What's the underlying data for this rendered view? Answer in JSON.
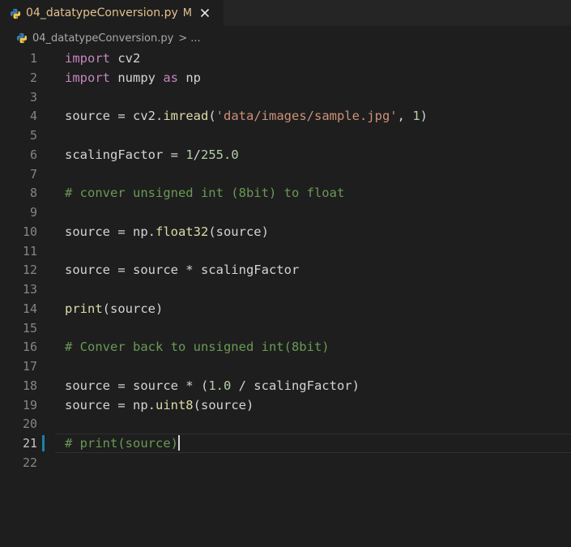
{
  "tab": {
    "title": "04_datatypeConversion.py",
    "status": "M",
    "file_icon": "python-icon",
    "close_icon": "close-icon"
  },
  "breadcrumb": {
    "file": "04_datatypeConversion.py",
    "separator": ">",
    "more": "..."
  },
  "editor": {
    "current_line": 21,
    "lines": [
      {
        "n": "1",
        "tokens": [
          {
            "t": "import",
            "c": "kw"
          },
          {
            "t": " cv2",
            "c": ""
          }
        ]
      },
      {
        "n": "2",
        "tokens": [
          {
            "t": "import",
            "c": "kw"
          },
          {
            "t": " numpy ",
            "c": ""
          },
          {
            "t": "as",
            "c": "kw"
          },
          {
            "t": " np",
            "c": ""
          }
        ]
      },
      {
        "n": "3",
        "tokens": []
      },
      {
        "n": "4",
        "tokens": [
          {
            "t": "source = cv2.",
            "c": ""
          },
          {
            "t": "imread",
            "c": "fn"
          },
          {
            "t": "(",
            "c": ""
          },
          {
            "t": "'data/images/sample.jpg'",
            "c": "str"
          },
          {
            "t": ", ",
            "c": ""
          },
          {
            "t": "1",
            "c": "num"
          },
          {
            "t": ")",
            "c": ""
          }
        ]
      },
      {
        "n": "5",
        "tokens": []
      },
      {
        "n": "6",
        "tokens": [
          {
            "t": "scalingFactor = ",
            "c": ""
          },
          {
            "t": "1",
            "c": "num"
          },
          {
            "t": "/",
            "c": ""
          },
          {
            "t": "255.0",
            "c": "num"
          }
        ]
      },
      {
        "n": "7",
        "tokens": []
      },
      {
        "n": "8",
        "tokens": [
          {
            "t": "# conver unsigned int (8bit) to float",
            "c": "cmt"
          }
        ]
      },
      {
        "n": "9",
        "tokens": []
      },
      {
        "n": "10",
        "tokens": [
          {
            "t": "source = np.",
            "c": ""
          },
          {
            "t": "float32",
            "c": "fn"
          },
          {
            "t": "(source)",
            "c": ""
          }
        ]
      },
      {
        "n": "11",
        "tokens": []
      },
      {
        "n": "12",
        "tokens": [
          {
            "t": "source = source * scalingFactor",
            "c": ""
          }
        ]
      },
      {
        "n": "13",
        "tokens": []
      },
      {
        "n": "14",
        "tokens": [
          {
            "t": "print",
            "c": "fn"
          },
          {
            "t": "(source)",
            "c": ""
          }
        ]
      },
      {
        "n": "15",
        "tokens": []
      },
      {
        "n": "16",
        "tokens": [
          {
            "t": "# Conver back to unsigned int(8bit)",
            "c": "cmt"
          }
        ]
      },
      {
        "n": "17",
        "tokens": []
      },
      {
        "n": "18",
        "tokens": [
          {
            "t": "source = source * (",
            "c": ""
          },
          {
            "t": "1.0",
            "c": "num"
          },
          {
            "t": " / scalingFactor)",
            "c": ""
          }
        ]
      },
      {
        "n": "19",
        "tokens": [
          {
            "t": "source = np.",
            "c": ""
          },
          {
            "t": "uint8",
            "c": "fn"
          },
          {
            "t": "(source)",
            "c": ""
          }
        ]
      },
      {
        "n": "20",
        "tokens": []
      },
      {
        "n": "21",
        "tokens": [
          {
            "t": "# print(source)",
            "c": "cmt"
          }
        ]
      },
      {
        "n": "22",
        "tokens": []
      }
    ]
  },
  "colors": {
    "background": "#1e1e1e",
    "tab_modified": "#e2c08d",
    "keyword": "#c586c0",
    "function": "#dcdcaa",
    "string": "#ce9178",
    "number": "#b5cea8",
    "comment": "#6a9955"
  }
}
